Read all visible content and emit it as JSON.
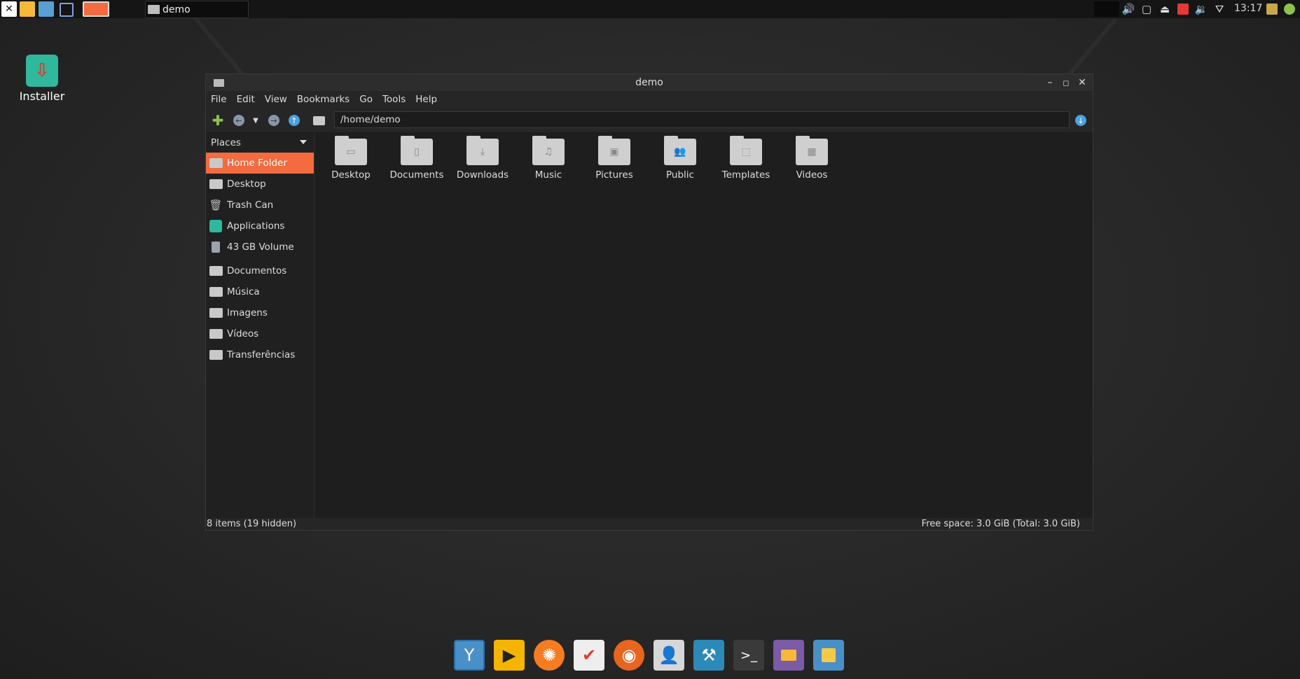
{
  "top_panel": {
    "task_title": "demo",
    "clock": "13:17"
  },
  "desktop": {
    "installer_label": "Installer"
  },
  "window": {
    "title": "demo",
    "menu": [
      "File",
      "Edit",
      "View",
      "Bookmarks",
      "Go",
      "Tools",
      "Help"
    ],
    "address": "/home/demo",
    "sidebar": {
      "header": "Places",
      "places": [
        "Home Folder",
        "Desktop",
        "Trash Can",
        "Applications",
        "43 GB Volume"
      ],
      "bookmarks": [
        "Documentos",
        "Música",
        "Imagens",
        "Vídeos",
        "Transferências"
      ]
    },
    "files": [
      "Desktop",
      "Documents",
      "Downloads",
      "Music",
      "Pictures",
      "Public",
      "Templates",
      "Videos"
    ],
    "status_left": "8 items (19 hidden)",
    "status_right": "Free space: 3.0 GiB (Total: 3.0 GiB)"
  },
  "colors": {
    "accent": "#f36b3f",
    "installer": "#2fb89c"
  }
}
